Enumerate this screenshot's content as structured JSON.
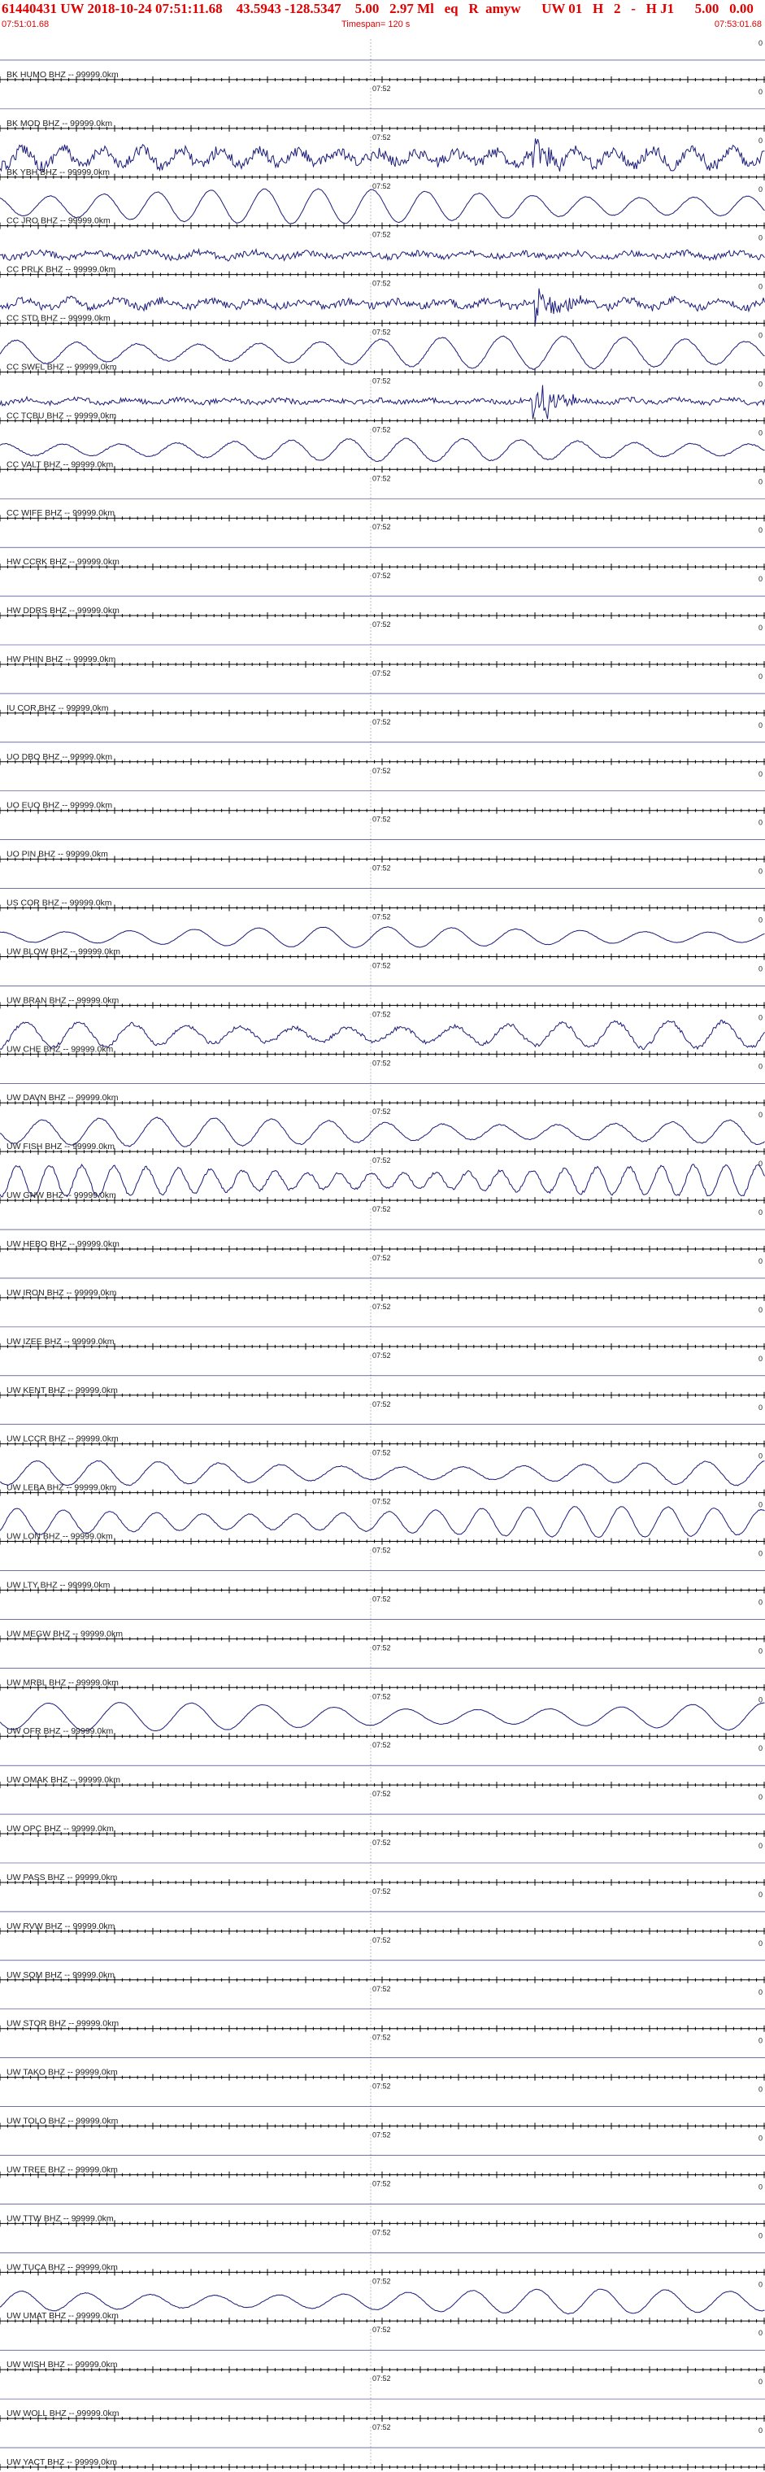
{
  "header": {
    "title": "61440431 UW 2018-10-24 07:51:11.68    43.5943 -128.5347    5.00   2.97 Ml   eq   R  amyw      UW 01   H   2   -   H J1      5.00   0.00",
    "start_time": "07:51:01.68",
    "timespan": "Timespan= 120 s",
    "end_time": "07:53:01.68"
  },
  "chart_data": {
    "type": "line",
    "mid_tick_label": "07:52",
    "right_edge_label": "0",
    "colors": {
      "trace": "#1a1a7a",
      "axis": "#000000",
      "header_text": "#e00000"
    },
    "traces": [
      {
        "label": "BK HUMO BHZ -- 99999.0km",
        "amp": 0,
        "period": 0,
        "noise": 0,
        "burst": 0
      },
      {
        "label": "BK MOD BHZ -- 99999.0km",
        "amp": 0,
        "period": 0,
        "noise": 0,
        "burst": 0
      },
      {
        "label": "BK YBH BHZ -- 99999.0km",
        "amp": 0.45,
        "period": 22,
        "noise": 0.45,
        "burst": 0.7
      },
      {
        "label": "CC JRO BHZ -- 99999.0km",
        "amp": 0.85,
        "period": 30,
        "noise": 0.03,
        "burst": 0
      },
      {
        "label": "CC PRLK BHZ -- 99999.0km",
        "amp": 0.15,
        "period": 30,
        "noise": 0.25,
        "burst": 0
      },
      {
        "label": "CC STD BHZ -- 99999.0km",
        "amp": 0.2,
        "period": 26,
        "noise": 0.3,
        "burst": 0.9
      },
      {
        "label": "CC SWFL BHZ -- 99999.0km",
        "amp": 0.8,
        "period": 34,
        "noise": 0.05,
        "burst": 0
      },
      {
        "label": "CC TCBU BHZ -- 99999.0km",
        "amp": 0.1,
        "period": 28,
        "noise": 0.2,
        "burst": 0.95
      },
      {
        "label": "CC VALT BHZ -- 99999.0km",
        "amp": 0.55,
        "period": 32,
        "noise": 0.05,
        "burst": 0
      },
      {
        "label": "CC WIFE BHZ -- 99999.0km",
        "amp": 0,
        "period": 0,
        "noise": 0,
        "burst": 0
      },
      {
        "label": "HW CCRK BHZ -- 99999.0km",
        "amp": 0,
        "period": 0,
        "noise": 0,
        "burst": 0
      },
      {
        "label": "HW DDRS BHZ -- 99999.0km",
        "amp": 0,
        "period": 0,
        "noise": 0,
        "burst": 0
      },
      {
        "label": "HW PHIN BHZ -- 99999.0km",
        "amp": 0,
        "period": 0,
        "noise": 0,
        "burst": 0
      },
      {
        "label": "IU COR BHZ -- 99999.0km",
        "amp": 0,
        "period": 0,
        "noise": 0,
        "burst": 0
      },
      {
        "label": "UO DBO BHZ -- 99999.0km",
        "amp": 0,
        "period": 0,
        "noise": 0,
        "burst": 0
      },
      {
        "label": "UO EUO BHZ -- 99999.0km",
        "amp": 0,
        "period": 0,
        "noise": 0,
        "burst": 0
      },
      {
        "label": "UO PIN BHZ -- 99999.0km",
        "amp": 0,
        "period": 0,
        "noise": 0,
        "burst": 0
      },
      {
        "label": "US COR BHZ -- 99999.0km",
        "amp": 0,
        "period": 0,
        "noise": 0,
        "burst": 0
      },
      {
        "label": "UW BLOW BHZ -- 99999.0km",
        "amp": 0.5,
        "period": 36,
        "noise": 0.02,
        "burst": 0
      },
      {
        "label": "UW BRAN BHZ -- 99999.0km",
        "amp": 0,
        "period": 0,
        "noise": 0,
        "burst": 0
      },
      {
        "label": "UW CHE BHZ -- 99999.0km",
        "amp": 0.65,
        "period": 30,
        "noise": 0.15,
        "burst": 0
      },
      {
        "label": "UW DAVN BHZ -- 99999.0km",
        "amp": 0,
        "period": 0,
        "noise": 0,
        "burst": 0
      },
      {
        "label": "UW FISH BHZ -- 99999.0km",
        "amp": 0.7,
        "period": 32,
        "noise": 0.05,
        "burst": 0
      },
      {
        "label": "UW GNW BHZ -- 99999.0km",
        "amp": 0.75,
        "period": 18,
        "noise": 0.12,
        "burst": 0
      },
      {
        "label": "UW HEBO BHZ -- 99999.0km",
        "amp": 0,
        "period": 0,
        "noise": 0,
        "burst": 0
      },
      {
        "label": "UW IRON BHZ -- 99999.0km",
        "amp": 0,
        "period": 0,
        "noise": 0,
        "burst": 0
      },
      {
        "label": "UW IZEE BHZ -- 99999.0km",
        "amp": 0,
        "period": 0,
        "noise": 0,
        "burst": 0
      },
      {
        "label": "UW KENT BHZ -- 99999.0km",
        "amp": 0,
        "period": 0,
        "noise": 0,
        "burst": 0
      },
      {
        "label": "UW LCCR BHZ -- 99999.0km",
        "amp": 0,
        "period": 0,
        "noise": 0,
        "burst": 0
      },
      {
        "label": "UW LEBA BHZ -- 99999.0km",
        "amp": 0.6,
        "period": 34,
        "noise": 0.04,
        "burst": 0
      },
      {
        "label": "UW LON BHZ -- 99999.0km",
        "amp": 0.75,
        "period": 26,
        "noise": 0.04,
        "burst": 0
      },
      {
        "label": "UW LTY BHZ -- 99999.0km",
        "amp": 0,
        "period": 0,
        "noise": 0,
        "burst": 0
      },
      {
        "label": "UW MEGW BHZ -- 99999.0km",
        "amp": 0,
        "period": 0,
        "noise": 0,
        "burst": 0
      },
      {
        "label": "UW MRBL BHZ -- 99999.0km",
        "amp": 0,
        "period": 0,
        "noise": 0,
        "burst": 0
      },
      {
        "label": "UW OFR BHZ -- 99999.0km",
        "amp": 0.7,
        "period": 40,
        "noise": 0.02,
        "burst": 0
      },
      {
        "label": "UW OMAK BHZ -- 99999.0km",
        "amp": 0,
        "period": 0,
        "noise": 0,
        "burst": 0
      },
      {
        "label": "UW OPC BHZ -- 99999.0km",
        "amp": 0,
        "period": 0,
        "noise": 0,
        "burst": 0
      },
      {
        "label": "UW PASS BHZ -- 99999.0km",
        "amp": 0,
        "period": 0,
        "noise": 0,
        "burst": 0
      },
      {
        "label": "UW RVW BHZ -- 99999.0km",
        "amp": 0,
        "period": 0,
        "noise": 0,
        "burst": 0
      },
      {
        "label": "UW SQM BHZ -- 99999.0km",
        "amp": 0,
        "period": 0,
        "noise": 0,
        "burst": 0
      },
      {
        "label": "UW STOR BHZ -- 99999.0km",
        "amp": 0,
        "period": 0,
        "noise": 0,
        "burst": 0
      },
      {
        "label": "UW TAKO BHZ -- 99999.0km",
        "amp": 0,
        "period": 0,
        "noise": 0,
        "burst": 0
      },
      {
        "label": "UW TOLO BHZ -- 99999.0km",
        "amp": 0,
        "period": 0,
        "noise": 0,
        "burst": 0
      },
      {
        "label": "UW TREE BHZ -- 99999.0km",
        "amp": 0,
        "period": 0,
        "noise": 0,
        "burst": 0
      },
      {
        "label": "UW TTW BHZ -- 99999.0km",
        "amp": 0,
        "period": 0,
        "noise": 0,
        "burst": 0
      },
      {
        "label": "UW TUCA BHZ -- 99999.0km",
        "amp": 0,
        "period": 0,
        "noise": 0,
        "burst": 0
      },
      {
        "label": "UW UMAT BHZ -- 99999.0km",
        "amp": 0.6,
        "period": 36,
        "noise": 0.03,
        "burst": 0
      },
      {
        "label": "UW WISH BHZ -- 99999.0km",
        "amp": 0,
        "period": 0,
        "noise": 0,
        "burst": 0
      },
      {
        "label": "UW WOLL BHZ -- 99999.0km",
        "amp": 0,
        "period": 0,
        "noise": 0,
        "burst": 0
      },
      {
        "label": "UW YACT BHZ -- 99999.0km",
        "amp": 0,
        "period": 0,
        "noise": 0,
        "burst": 0
      }
    ]
  }
}
